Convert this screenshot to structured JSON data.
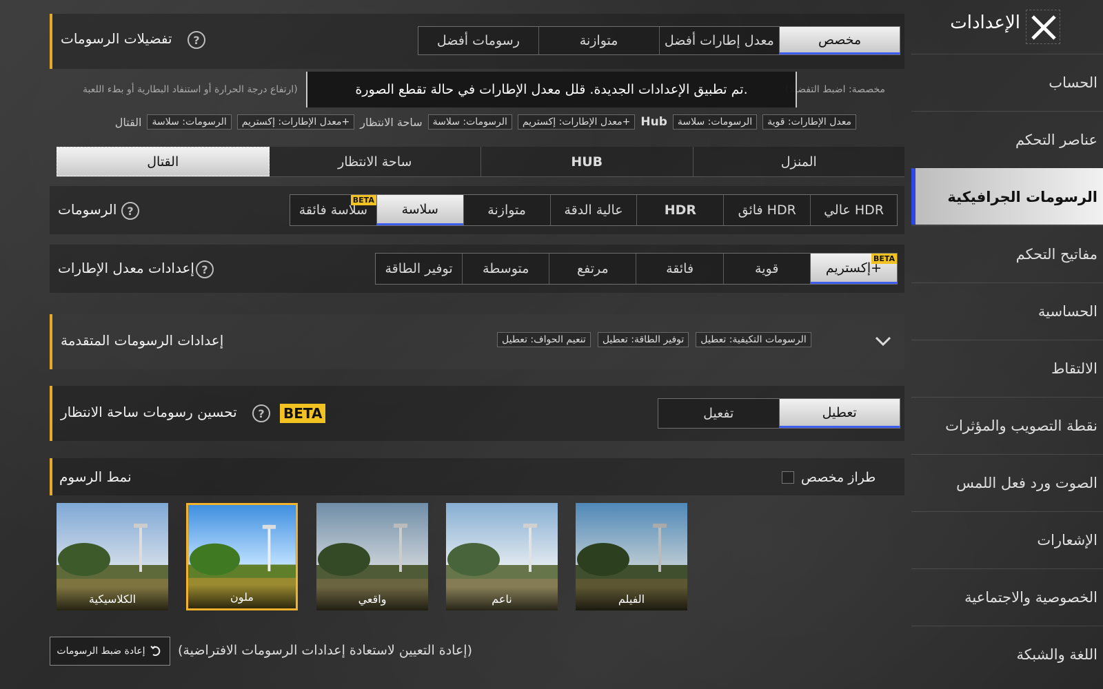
{
  "sidebar": {
    "title": "الإعدادات",
    "items": [
      {
        "label": "الحساب"
      },
      {
        "label": "عناصر التحكم"
      },
      {
        "label": "الرسومات الجرافيكية"
      },
      {
        "label": "مفاتيح التحكم"
      },
      {
        "label": "الحساسية"
      },
      {
        "label": "الالتقاط"
      },
      {
        "label": "نقطة التصويب والمؤثرات"
      },
      {
        "label": "الصوت ورد فعل اللمس"
      },
      {
        "label": "الإشعارات"
      },
      {
        "label": "الخصوصية والاجتماعية"
      },
      {
        "label": "اللغة والشبكة"
      }
    ],
    "active_index": 2
  },
  "prefs": {
    "title": "تفضيلات الرسومات",
    "options": [
      "مخصص",
      "معدل إطارات أفضل",
      "متوازنة",
      "رسومات أفضل"
    ],
    "selected": 0,
    "hint_left": "(مخصصة: اضبط التفضيلا",
    "hint_right": "ارتفاع درجة الحرارة أو استنفاد البطارية أو بطء اللعبة)",
    "toast": "تم تطبيق الإعدادات الجديدة. قلل معدل الإطارات في حالة تقطع الصورة."
  },
  "summary": {
    "home": [
      "معدل الإطارات: قوية",
      "الرسومات: سلاسة"
    ],
    "hub_label": "Hub",
    "hub": [
      "معدل الإطارات: إكستريم+",
      "الرسومات: سلاسة"
    ],
    "lobby_label": "ساحة الانتظار",
    "lobby": [
      "معدل الإطارات: إكستريم+",
      "الرسومات: سلاسة"
    ],
    "combat_label": "القتال"
  },
  "mode_tabs": {
    "options": [
      "المنزل",
      "HUB",
      "ساحة الانتظار",
      "القتال"
    ],
    "selected": 3
  },
  "graphics": {
    "label": "الرسومات",
    "options": [
      "عالي HDR",
      "فائق HDR",
      "HDR",
      "عالية الدقة",
      "متوازنة",
      "سلاسة",
      "سلاسة فائقة"
    ],
    "selected": 5,
    "beta_index": 6,
    "beta": "BETA"
  },
  "framerate": {
    "label": "إعدادات معدل الإطارات",
    "options": [
      "إكستريم+",
      "قوية",
      "فائقة",
      "مرتفع",
      "متوسطة",
      "توفير الطاقة"
    ],
    "selected": 0,
    "beta_index": 0,
    "beta": "BETA"
  },
  "advanced": {
    "title": "إعدادات الرسومات المتقدمة",
    "chips": [
      "الرسومات التكيفية: تعطيل",
      "توفير الطاقة: تعطيل",
      "تنعيم الحواف: تعطيل"
    ]
  },
  "lobby_opt": {
    "title": "تحسين رسومات ساحة الانتظار",
    "beta": "BETA",
    "options": [
      "تعطيل",
      "تفعيل"
    ],
    "selected": 0
  },
  "style": {
    "title": "نمط الرسوم",
    "custom_label": "طراز مخصص",
    "thumbs": [
      "الكلاسيكية",
      "ملون",
      "واقعي",
      "ناعم",
      "الفيلم"
    ],
    "selected": 1
  },
  "reset": {
    "button": "إعادة ضبط الرسومات",
    "note": "(إعادة التعيين لاستعادة إعدادات الرسومات الافتراضية)"
  },
  "colors": {
    "accent": "#e8a92a",
    "select_underline": "#3d5cf0",
    "beta": "#f2c122"
  }
}
